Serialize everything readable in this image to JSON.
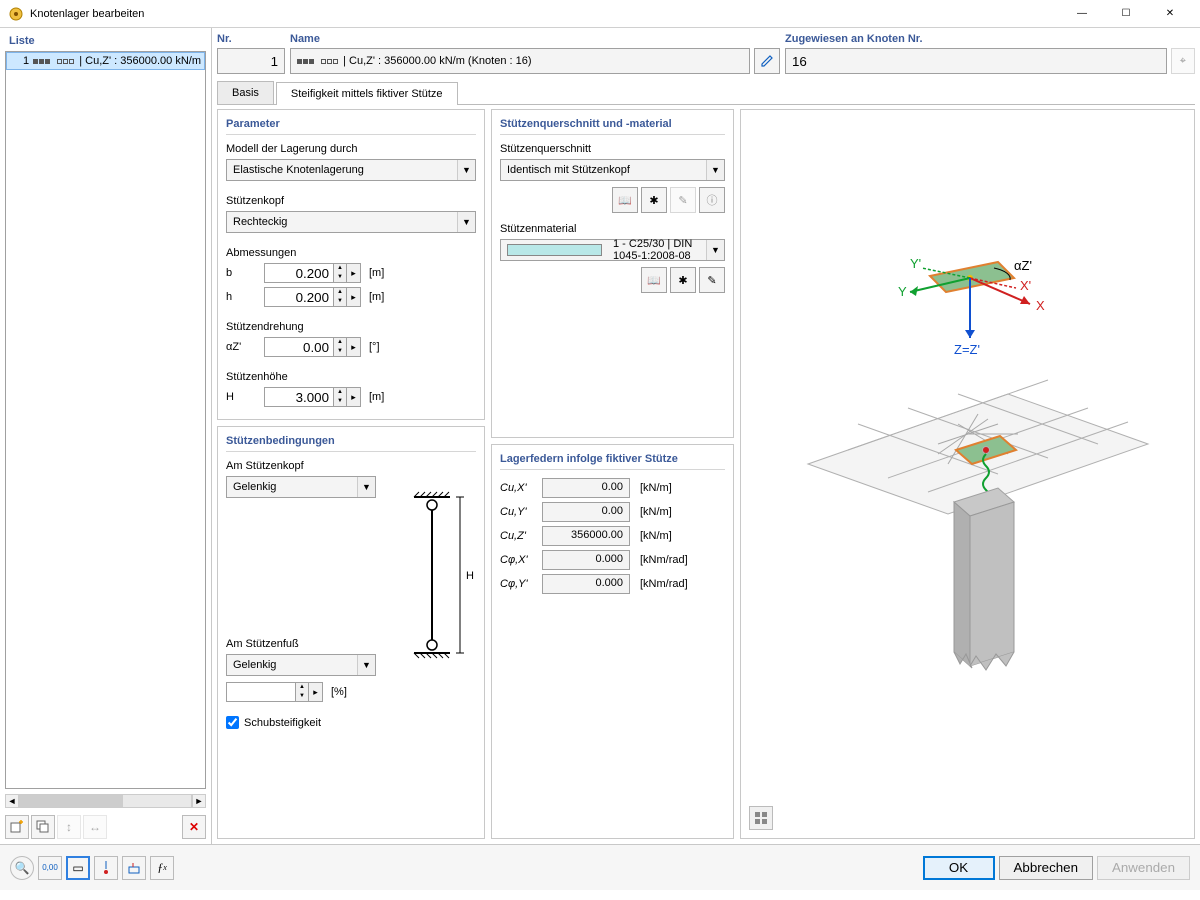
{
  "window": {
    "title": "Knotenlager bearbeiten"
  },
  "list": {
    "heading": "Liste",
    "item_number": "1",
    "item_text": "| Cu,Z' : 356000.00 kN/m"
  },
  "toolbar_left": {
    "new": "✱",
    "copy": "⧉",
    "renum1": "↕",
    "renum2": "↔",
    "delete": "✕"
  },
  "header": {
    "nr_label": "Nr.",
    "nr_value": "1",
    "name_label": "Name",
    "name_text": "| Cu,Z' : 356000.00 kN/m (Knoten : 16)",
    "assigned_label": "Zugewiesen an Knoten Nr.",
    "assigned_value": "16"
  },
  "tabs": {
    "basis": "Basis",
    "stiffness": "Steifigkeit mittels fiktiver Stütze"
  },
  "parameter": {
    "heading": "Parameter",
    "model_label": "Modell der Lagerung durch",
    "model_value": "Elastische Knotenlagerung",
    "head_label": "Stützenkopf",
    "head_value": "Rechteckig",
    "dims_label": "Abmessungen",
    "b_label": "b",
    "b_value": "0.200",
    "b_unit": "[m]",
    "h_label": "h",
    "h_value": "0.200",
    "h_unit": "[m]",
    "rot_label": "Stützendrehung",
    "alpha_label": "αZ'",
    "alpha_value": "0.00",
    "alpha_unit": "[°]",
    "height_label": "Stützenhöhe",
    "H_label": "H",
    "H_value": "3.000",
    "H_unit": "[m]"
  },
  "conditions": {
    "heading": "Stützenbedingungen",
    "top_label": "Am Stützenkopf",
    "top_value": "Gelenkig",
    "bottom_label": "Am Stützenfuß",
    "bottom_value": "Gelenkig",
    "pct_unit": "[%]",
    "shear_label": "Schubsteifigkeit"
  },
  "cross_section": {
    "heading": "Stützenquerschnitt und -material",
    "cs_label": "Stützenquerschnitt",
    "cs_value": "Identisch mit Stützenkopf",
    "mat_label": "Stützenmaterial",
    "mat_value": "1 - C25/30 | DIN 1045-1:2008-08"
  },
  "springs": {
    "heading": "Lagerfedern infolge fiktiver Stütze",
    "rows": [
      {
        "label": "Cu,X'",
        "value": "0.00",
        "unit": "[kN/m]"
      },
      {
        "label": "Cu,Y'",
        "value": "0.00",
        "unit": "[kN/m]"
      },
      {
        "label": "Cu,Z'",
        "value": "356000.00",
        "unit": "[kN/m]"
      },
      {
        "label": "Cφ,X'",
        "value": "0.000",
        "unit": "[kNm/rad]"
      },
      {
        "label": "Cφ,Y'",
        "value": "0.000",
        "unit": "[kNm/rad]"
      }
    ]
  },
  "preview_axes": {
    "x": "X",
    "xp": "X'",
    "y": "Y",
    "yp": "Y'",
    "z": "Z=Z'",
    "alpha": "αZ'"
  },
  "footer_toolbar": {
    "help": "?",
    "units": "0,00",
    "view": "▭",
    "pick": "✶",
    "disp": "▤",
    "fx": "f(x)"
  },
  "buttons": {
    "ok": "OK",
    "cancel": "Abbrechen",
    "apply": "Anwenden"
  },
  "icons": {
    "library": "📖",
    "new": "✱",
    "edit": "✎",
    "info": "ⓘ",
    "new2": "✱",
    "pen": "✎",
    "pick": "⌖"
  }
}
